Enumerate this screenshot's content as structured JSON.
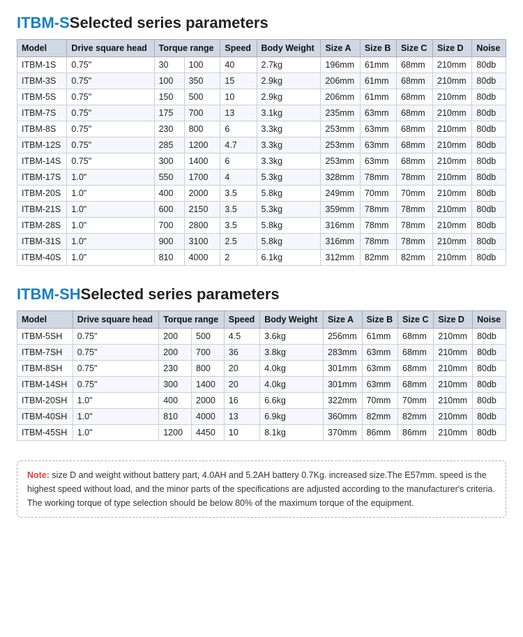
{
  "section1": {
    "title_blue": "ITBM-S",
    "title_rest": "Selected series parameters",
    "headers": [
      "Model",
      "Drive square head",
      "Torque range",
      "",
      "Speed",
      "Body Weight",
      "Size A",
      "Size B",
      "Size C",
      "Size D",
      "Noise"
    ],
    "columns": [
      "model",
      "drive_square_head",
      "torque_min",
      "torque_max",
      "speed",
      "body_weight",
      "size_a",
      "size_b",
      "size_c",
      "size_d",
      "noise"
    ],
    "col_labels": [
      "Model",
      "Drive square head",
      "Torque range",
      "Speed",
      "Body Weight",
      "Size A",
      "Size B",
      "Size C",
      "Size D",
      "Noise"
    ],
    "rows": [
      [
        "ITBM-1S",
        "0.75\"",
        "30",
        "100",
        "40",
        "2.7kg",
        "196mm",
        "61mm",
        "68mm",
        "210mm",
        "80db"
      ],
      [
        "ITBM-3S",
        "0.75\"",
        "100",
        "350",
        "15",
        "2.9kg",
        "206mm",
        "61mm",
        "68mm",
        "210mm",
        "80db"
      ],
      [
        "ITBM-5S",
        "0.75\"",
        "150",
        "500",
        "10",
        "2.9kg",
        "206mm",
        "61mm",
        "68mm",
        "210mm",
        "80db"
      ],
      [
        "ITBM-7S",
        "0.75\"",
        "175",
        "700",
        "13",
        "3.1kg",
        "235mm",
        "63mm",
        "68mm",
        "210mm",
        "80db"
      ],
      [
        "ITBM-8S",
        "0.75\"",
        "230",
        "800",
        "6",
        "3.3kg",
        "253mm",
        "63mm",
        "68mm",
        "210mm",
        "80db"
      ],
      [
        "ITBM-12S",
        "0.75\"",
        "285",
        "1200",
        "4.7",
        "3.3kg",
        "253mm",
        "63mm",
        "68mm",
        "210mm",
        "80db"
      ],
      [
        "ITBM-14S",
        "0.75\"",
        "300",
        "1400",
        "6",
        "3.3kg",
        "253mm",
        "63mm",
        "68mm",
        "210mm",
        "80db"
      ],
      [
        "ITBM-17S",
        "1.0\"",
        "550",
        "1700",
        "4",
        "5.3kg",
        "328mm",
        "78mm",
        "78mm",
        "210mm",
        "80db"
      ],
      [
        "ITBM-20S",
        "1.0\"",
        "400",
        "2000",
        "3.5",
        "5.8kg",
        "249mm",
        "70mm",
        "70mm",
        "210mm",
        "80db"
      ],
      [
        "ITBM-21S",
        "1.0\"",
        "600",
        "2150",
        "3.5",
        "5.3kg",
        "359mm",
        "78mm",
        "78mm",
        "210mm",
        "80db"
      ],
      [
        "ITBM-28S",
        "1.0\"",
        "700",
        "2800",
        "3.5",
        "5.8kg",
        "316mm",
        "78mm",
        "78mm",
        "210mm",
        "80db"
      ],
      [
        "ITBM-31S",
        "1.0\"",
        "900",
        "3100",
        "2.5",
        "5.8kg",
        "316mm",
        "78mm",
        "78mm",
        "210mm",
        "80db"
      ],
      [
        "ITBM-40S",
        "1.0\"",
        "810",
        "4000",
        "2",
        "6.1kg",
        "312mm",
        "82mm",
        "82mm",
        "210mm",
        "80db"
      ]
    ]
  },
  "section2": {
    "title_blue": "ITBM-SH",
    "title_rest": "Selected series parameters",
    "col_labels": [
      "Model",
      "Drive square head",
      "Torque range",
      "Speed",
      "Body Weight",
      "Size A",
      "Size B",
      "Size C",
      "Size D",
      "Noise"
    ],
    "rows": [
      [
        "ITBM-5SH",
        "0.75\"",
        "200",
        "500",
        "4.5",
        "3.6kg",
        "256mm",
        "61mm",
        "68mm",
        "210mm",
        "80db"
      ],
      [
        "ITBM-7SH",
        "0.75\"",
        "200",
        "700",
        "36",
        "3.8kg",
        "283mm",
        "63mm",
        "68mm",
        "210mm",
        "80db"
      ],
      [
        "ITBM-8SH",
        "0.75\"",
        "230",
        "800",
        "20",
        "4.0kg",
        "301mm",
        "63mm",
        "68mm",
        "210mm",
        "80db"
      ],
      [
        "ITBM-14SH",
        "0.75\"",
        "300",
        "1400",
        "20",
        "4.0kg",
        "301mm",
        "63mm",
        "68mm",
        "210mm",
        "80db"
      ],
      [
        "ITBM-20SH",
        "1.0\"",
        "400",
        "2000",
        "16",
        "6.6kg",
        "322mm",
        "70mm",
        "70mm",
        "210mm",
        "80db"
      ],
      [
        "ITBM-40SH",
        "1.0\"",
        "810",
        "4000",
        "13",
        "6.9kg",
        "360mm",
        "82mm",
        "82mm",
        "210mm",
        "80db"
      ],
      [
        "ITBM-45SH",
        "1.0\"",
        "1200",
        "4450",
        "10",
        "8.1kg",
        "370mm",
        "86mm",
        "86mm",
        "210mm",
        "80db"
      ]
    ]
  },
  "note": {
    "label": "Note:",
    "text": " size D and weight without battery part, 4.0AH and 5.2AH battery 0.7Kg. increased size.The E57mm. speed is the highest speed without load, and the minor parts of the specifications are adjusted according to the manufacturer's criteria.\nThe working torque of type selection should be below 80% of the maximum torque of the equipment."
  }
}
